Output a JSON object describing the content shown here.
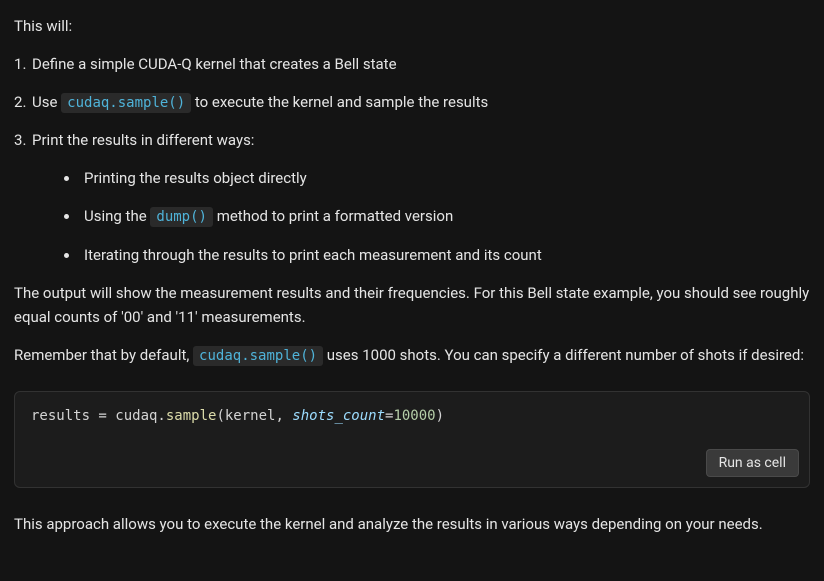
{
  "intro": "This will:",
  "ol": {
    "item1": "Define a simple CUDA-Q kernel that creates a Bell state",
    "item2_pre": "Use ",
    "item2_code": "cudaq.sample()",
    "item2_post": " to execute the kernel and sample the results",
    "item3": "Print the results in different ways:"
  },
  "sub": {
    "s1": "Printing the results object directly",
    "s2_pre": "Using the ",
    "s2_code": "dump()",
    "s2_post": " method to print a formatted version",
    "s3": "Iterating through the results to print each measurement and its count"
  },
  "para1": "The output will show the measurement results and their frequencies. For this Bell state example, you should see roughly equal counts of '00' and '11' measurements.",
  "para2_pre": "Remember that by default, ",
  "para2_code": "cudaq.sample()",
  "para2_post": " uses 1000 shots. You can specify a different number of shots if desired:",
  "code": {
    "t1": "results = cudaq.",
    "t2": "sample",
    "t3": "(kernel, ",
    "t4": "shots_count",
    "t5": "=",
    "t6": "10000",
    "t7": ")"
  },
  "run_label": "Run as cell",
  "para3": "This approach allows you to execute the kernel and analyze the results in various ways depending on your needs."
}
